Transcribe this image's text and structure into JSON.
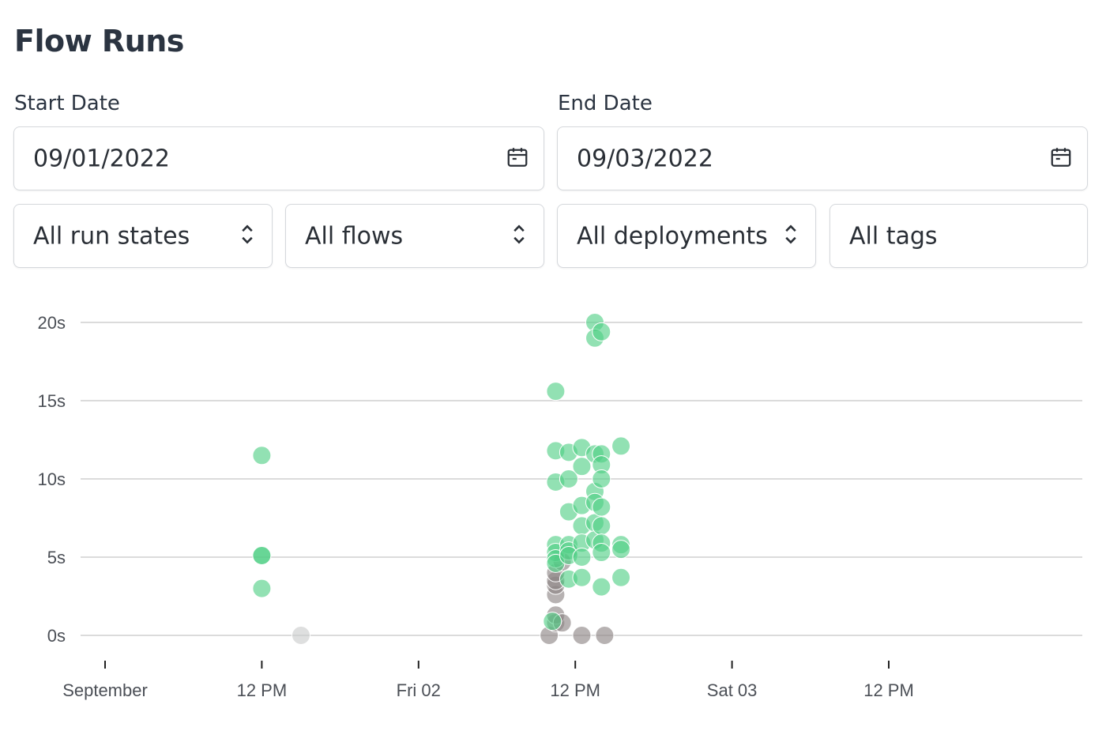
{
  "page": {
    "title": "Flow Runs"
  },
  "filters": {
    "start_date": {
      "label": "Start Date",
      "value": "09/01/2022",
      "icon": "calendar-icon"
    },
    "end_date": {
      "label": "End Date",
      "value": "09/03/2022",
      "icon": "calendar-icon"
    },
    "run_states": {
      "value": "All run states",
      "icon": "chevron-up-down-icon"
    },
    "flows": {
      "value": "All flows",
      "icon": "chevron-up-down-icon"
    },
    "deployments": {
      "value": "All deployments",
      "icon": "chevron-up-down-icon"
    },
    "tags": {
      "value": "All tags"
    }
  },
  "colors": {
    "completed": "#4fce85",
    "other": "#8a8383",
    "scheduled": "#c9cccc",
    "grid": "#cfcfcf"
  },
  "chart_data": {
    "type": "scatter",
    "title": "",
    "xlabel": "",
    "ylabel": "",
    "x_ticks": [
      {
        "t": "2022-09-01 00:00",
        "label": "September"
      },
      {
        "t": "2022-09-01 12:00",
        "label": "12 PM"
      },
      {
        "t": "2022-09-02 00:00",
        "label": "Fri 02"
      },
      {
        "t": "2022-09-02 12:00",
        "label": "12 PM"
      },
      {
        "t": "2022-09-03 00:00",
        "label": "Sat 03"
      },
      {
        "t": "2022-09-03 12:00",
        "label": "12 PM"
      }
    ],
    "y_ticks": [
      {
        "v": 0,
        "label": "0s"
      },
      {
        "v": 5,
        "label": "5s"
      },
      {
        "v": 10,
        "label": "10s"
      },
      {
        "v": 15,
        "label": "15s"
      },
      {
        "v": 20,
        "label": "20s"
      }
    ],
    "xlim": [
      "2022-09-01 00:00",
      "2022-09-04 00:00"
    ],
    "ylim": [
      0,
      20
    ],
    "grid": true,
    "legend": "none",
    "series": [
      {
        "state": "completed",
        "points": [
          [
            "2022-09-01 12:00",
            11.5
          ],
          [
            "2022-09-01 12:00",
            5.1
          ],
          [
            "2022-09-01 12:00",
            5.1
          ],
          [
            "2022-09-01 12:00",
            3.0
          ],
          [
            "2022-09-02 10:30",
            15.6
          ],
          [
            "2022-09-02 10:30",
            11.8
          ],
          [
            "2022-09-02 10:30",
            9.8
          ],
          [
            "2022-09-02 10:30",
            5.8
          ],
          [
            "2022-09-02 10:30",
            5.3
          ],
          [
            "2022-09-02 10:30",
            4.9
          ],
          [
            "2022-09-02 10:30",
            4.6
          ],
          [
            "2022-09-02 11:30",
            11.7
          ],
          [
            "2022-09-02 11:30",
            10.0
          ],
          [
            "2022-09-02 11:30",
            7.9
          ],
          [
            "2022-09-02 11:30",
            5.8
          ],
          [
            "2022-09-02 11:30",
            5.4
          ],
          [
            "2022-09-02 11:30",
            5.1
          ],
          [
            "2022-09-02 11:30",
            3.6
          ],
          [
            "2022-09-02 12:30",
            12.0
          ],
          [
            "2022-09-02 12:30",
            10.8
          ],
          [
            "2022-09-02 12:30",
            8.3
          ],
          [
            "2022-09-02 12:30",
            7.0
          ],
          [
            "2022-09-02 12:30",
            5.9
          ],
          [
            "2022-09-02 12:30",
            5.0
          ],
          [
            "2022-09-02 12:30",
            3.7
          ],
          [
            "2022-09-02 13:30",
            20.0
          ],
          [
            "2022-09-02 13:30",
            19.0
          ],
          [
            "2022-09-02 13:30",
            11.6
          ],
          [
            "2022-09-02 13:30",
            9.2
          ],
          [
            "2022-09-02 13:30",
            8.5
          ],
          [
            "2022-09-02 13:30",
            7.2
          ],
          [
            "2022-09-02 13:30",
            6.1
          ],
          [
            "2022-09-02 14:00",
            19.4
          ],
          [
            "2022-09-02 14:00",
            11.6
          ],
          [
            "2022-09-02 14:00",
            10.9
          ],
          [
            "2022-09-02 14:00",
            10.0
          ],
          [
            "2022-09-02 14:00",
            8.2
          ],
          [
            "2022-09-02 14:00",
            7.0
          ],
          [
            "2022-09-02 14:00",
            5.9
          ],
          [
            "2022-09-02 14:00",
            5.3
          ],
          [
            "2022-09-02 14:00",
            3.1
          ],
          [
            "2022-09-02 15:30",
            12.1
          ],
          [
            "2022-09-02 15:30",
            5.8
          ],
          [
            "2022-09-02 15:30",
            5.5
          ],
          [
            "2022-09-02 15:30",
            3.7
          ],
          [
            "2022-09-02 10:15",
            0.9
          ]
        ]
      },
      {
        "state": "other",
        "points": [
          [
            "2022-09-02 10:00",
            0.0
          ],
          [
            "2022-09-02 10:30",
            0.8
          ],
          [
            "2022-09-02 10:30",
            1.3
          ],
          [
            "2022-09-02 10:30",
            2.6
          ],
          [
            "2022-09-02 10:30",
            3.2
          ],
          [
            "2022-09-02 10:30",
            3.5
          ],
          [
            "2022-09-02 10:30",
            4.0
          ],
          [
            "2022-09-02 11:00",
            0.8
          ],
          [
            "2022-09-02 11:00",
            4.7
          ],
          [
            "2022-09-02 12:30",
            0.0
          ],
          [
            "2022-09-02 14:15",
            0.0
          ]
        ]
      },
      {
        "state": "scheduled",
        "points": [
          [
            "2022-09-01 15:00",
            0.0
          ]
        ]
      }
    ]
  }
}
